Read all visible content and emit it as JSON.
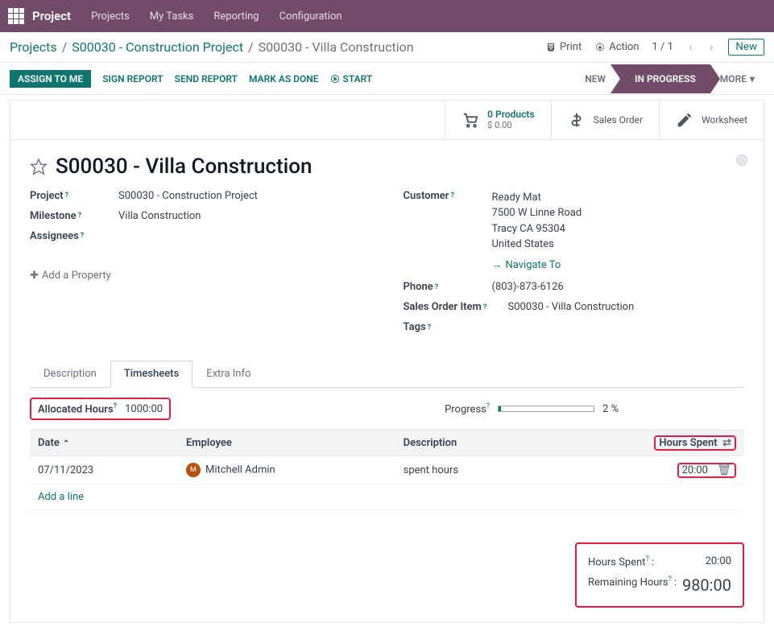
{
  "topnav": {
    "brand": "Project",
    "menu": [
      "Projects",
      "My Tasks",
      "Reporting",
      "Configuration"
    ]
  },
  "breadcrumb": {
    "items": [
      "Projects",
      "S00030 - Construction Project"
    ],
    "current": "S00030 - Villa Construction"
  },
  "controls": {
    "print": "Print",
    "action": "Action",
    "pager": "1 / 1",
    "new": "New"
  },
  "statusbar": {
    "assign": "ASSIGN TO ME",
    "sign_report": "SIGN REPORT",
    "send_report": "SEND REPORT",
    "mark_done": "MARK AS DONE",
    "start": "START",
    "stages": [
      "NEW",
      "IN PROGRESS"
    ],
    "more": "MORE"
  },
  "stat_buttons": {
    "products_line1": "0 Products",
    "products_line2": "$ 0.00",
    "sales_order": "Sales Order",
    "worksheet": "Worksheet"
  },
  "title": "S00030 - Villa Construction",
  "fields": {
    "project_label": "Project",
    "project_value": "S00030 - Construction Project",
    "milestone_label": "Milestone",
    "milestone_value": "Villa Construction",
    "assignees_label": "Assignees",
    "customer_label": "Customer",
    "customer_name": "Ready Mat",
    "customer_street": "7500 W Linne Road",
    "customer_city": "Tracy CA 95304",
    "customer_country": "United States",
    "navigate_to": "Navigate To",
    "phone_label": "Phone",
    "phone_value": "(803)-873-6126",
    "sales_order_item_label": "Sales Order Item",
    "sales_order_item_value": "S00030 - Villa Construction",
    "tags_label": "Tags",
    "add_property": "Add a Property"
  },
  "tabs": [
    "Description",
    "Timesheets",
    "Extra Info"
  ],
  "timesheet": {
    "allocated_label": "Allocated Hours",
    "allocated_value": "1000:00",
    "progress_label": "Progress",
    "progress_value": "2 %",
    "columns": {
      "date": "Date",
      "employee": "Employee",
      "description": "Description",
      "hours_spent": "Hours Spent"
    },
    "rows": [
      {
        "date": "07/11/2023",
        "employee": "Mitchell Admin",
        "description": "spent hours",
        "hours": "20:00"
      }
    ],
    "add_line": "Add a line",
    "summary_hours_label": "Hours Spent",
    "summary_hours_value": "20:00",
    "summary_remaining_label": "Remaining Hours",
    "summary_remaining_value": "980:00"
  }
}
